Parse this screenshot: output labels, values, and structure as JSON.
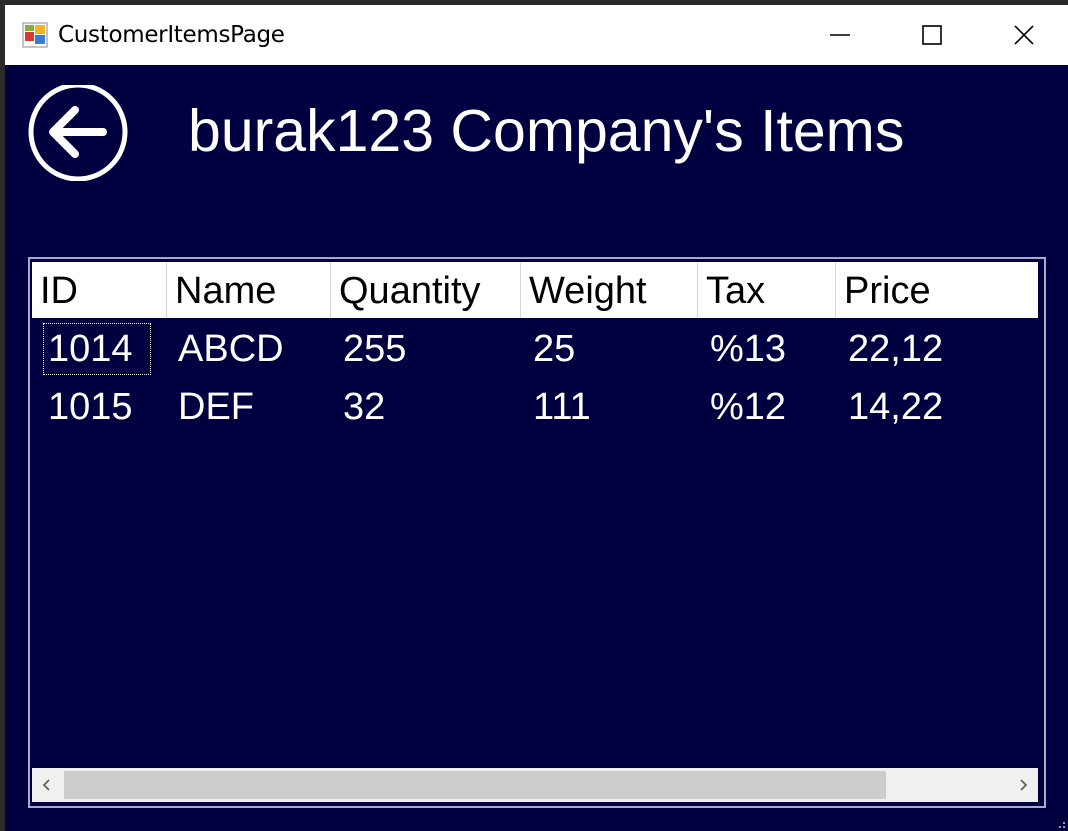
{
  "window": {
    "title": "CustomerItemsPage"
  },
  "titlebar": {
    "icons": {
      "app": "app-icon",
      "minimize": "minimize-icon",
      "maximize": "maximize-icon",
      "close": "close-icon"
    }
  },
  "header": {
    "back_icon": "back-arrow-icon",
    "title": "burak123 Company's Items"
  },
  "grid": {
    "columns": [
      "ID",
      "Name",
      "Quantity",
      "Weight",
      "Tax",
      "Price"
    ],
    "rows": [
      [
        "1014",
        "ABCD",
        "255",
        "25",
        "%13",
        "22,12"
      ],
      [
        "1015",
        "DEF",
        "32",
        "111",
        "%12",
        "14,22"
      ]
    ],
    "focused_cell": "1014"
  },
  "scrollbar": {
    "left_icon": "chevron-left-icon",
    "right_icon": "chevron-right-icon"
  },
  "colors": {
    "background": "#000040",
    "text": "#ffffff",
    "header_bg": "#ffffff",
    "titlebar_bg": "#ffffff"
  }
}
